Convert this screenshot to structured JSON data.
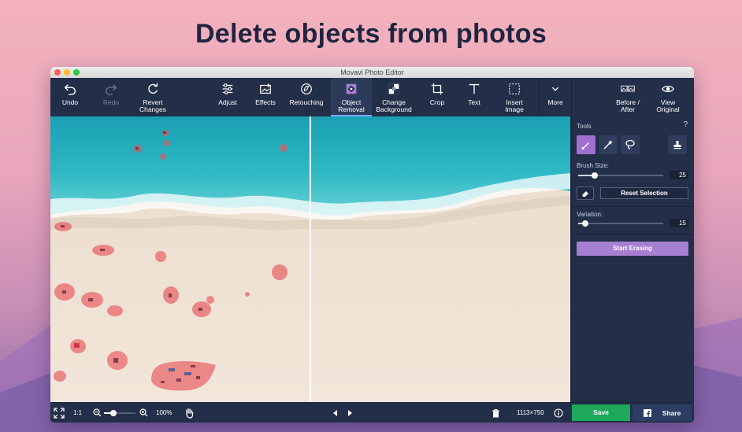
{
  "headline": "Delete objects from photos",
  "window": {
    "title": "Movavi Photo Editor"
  },
  "toolbar": {
    "undo": "Undo",
    "redo": "Redo",
    "revert_line1": "Revert",
    "revert_line2": "Changes",
    "adjust": "Adjust",
    "effects": "Effects",
    "retouching": "Retouching",
    "object_removal_line1": "Object",
    "object_removal_line2": "Removal",
    "change_bg_line1": "Change",
    "change_bg_line2": "Background",
    "crop": "Crop",
    "text": "Text",
    "insert_line1": "Insert",
    "insert_line2": "Image",
    "more": "More",
    "before_after_line1": "Before /",
    "before_after_line2": "After",
    "view_original_line1": "View",
    "view_original_line2": "Original"
  },
  "panel": {
    "tools_label": "Tools",
    "help": "?",
    "brush_size_label": "Brush Size:",
    "brush_size_value": "25",
    "brush_size_fraction": 0.19,
    "reset_selection": "Reset Selection",
    "variation_label": "Variation:",
    "variation_value": "15",
    "variation_fraction": 0.08,
    "start_erasing": "Start Erasing"
  },
  "statusbar": {
    "actual_size": "1:1",
    "zoom": "100%",
    "zoom_fraction": 0.3,
    "dimensions": "1113×750",
    "save": "Save",
    "share": "Share"
  },
  "colors": {
    "window_bg": "#232f48",
    "accent_purple": "#a77fd2",
    "save_green": "#1ea85a",
    "selection_red": "#e8545a"
  }
}
